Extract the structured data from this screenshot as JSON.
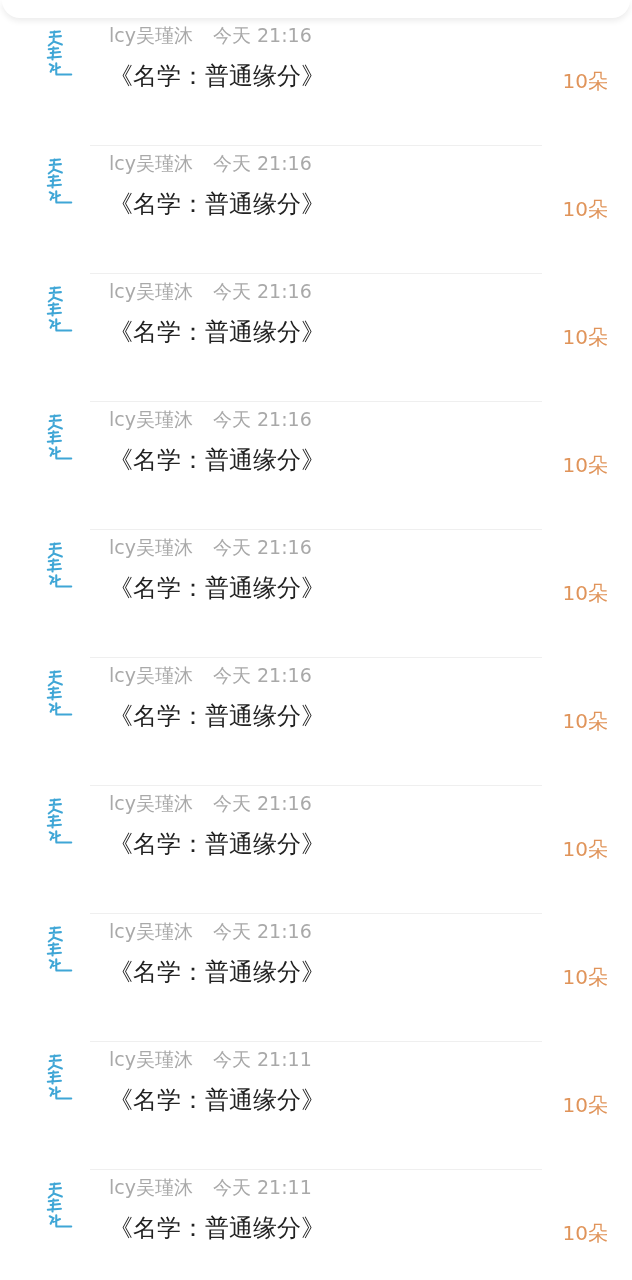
{
  "gifts": [
    {
      "user": "lcy吴瑾沐",
      "time": "今天 21:16",
      "title": "《名学：普通缘分》",
      "amount": "10朵"
    },
    {
      "user": "lcy吴瑾沐",
      "time": "今天 21:16",
      "title": "《名学：普通缘分》",
      "amount": "10朵"
    },
    {
      "user": "lcy吴瑾沐",
      "time": "今天 21:16",
      "title": "《名学：普通缘分》",
      "amount": "10朵"
    },
    {
      "user": "lcy吴瑾沐",
      "time": "今天 21:16",
      "title": "《名学：普通缘分》",
      "amount": "10朵"
    },
    {
      "user": "lcy吴瑾沐",
      "time": "今天 21:16",
      "title": "《名学：普通缘分》",
      "amount": "10朵"
    },
    {
      "user": "lcy吴瑾沐",
      "time": "今天 21:16",
      "title": "《名学：普通缘分》",
      "amount": "10朵"
    },
    {
      "user": "lcy吴瑾沐",
      "time": "今天 21:16",
      "title": "《名学：普通缘分》",
      "amount": "10朵"
    },
    {
      "user": "lcy吴瑾沐",
      "time": "今天 21:16",
      "title": "《名学：普通缘分》",
      "amount": "10朵"
    },
    {
      "user": "lcy吴瑾沐",
      "time": "今天 21:11",
      "title": "《名学：普通缘分》",
      "amount": "10朵"
    },
    {
      "user": "lcy吴瑾沐",
      "time": "今天 21:11",
      "title": "《名学：普通缘分》",
      "amount": "10朵"
    }
  ]
}
